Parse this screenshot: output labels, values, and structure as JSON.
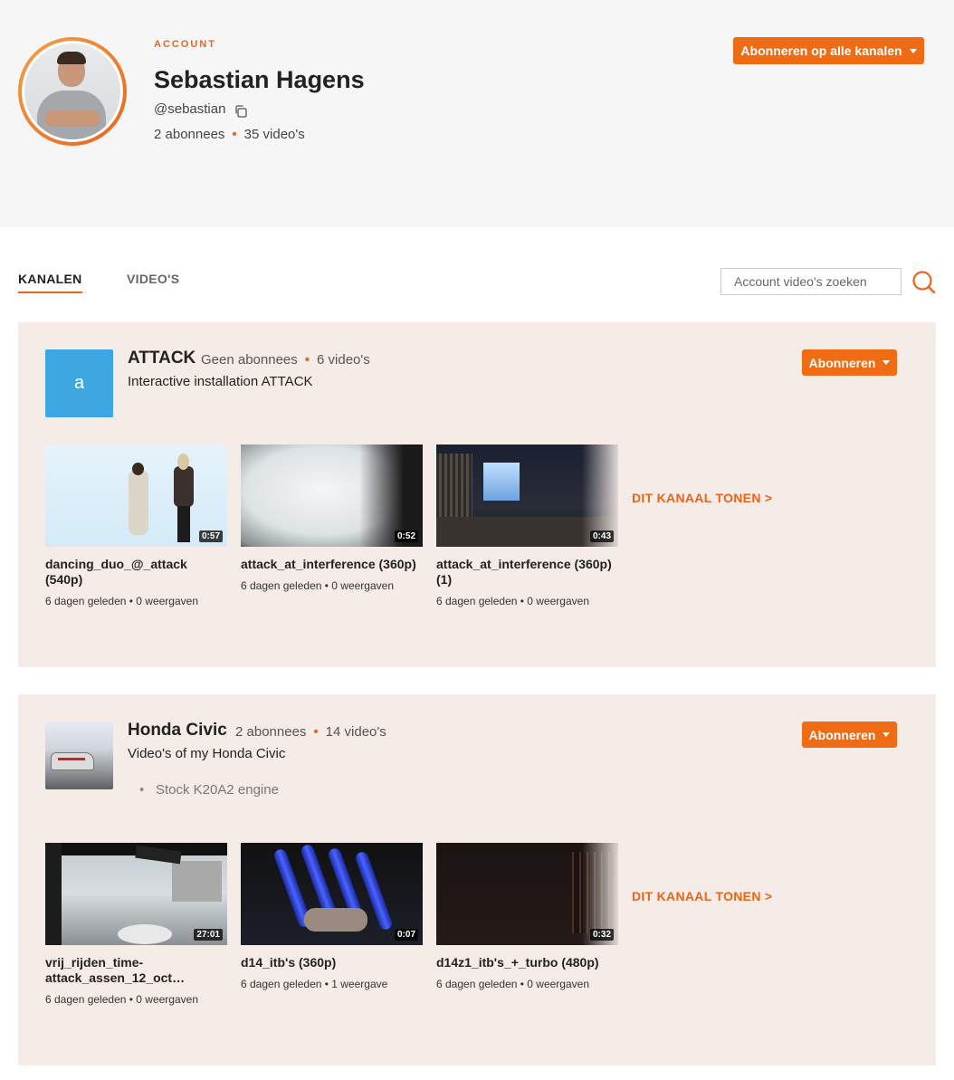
{
  "header": {
    "kicker": "ACCOUNT",
    "name": "Sebastian Hagens",
    "handle": "@sebastian",
    "subscribers": "2 abonnees",
    "videos": "35 video's",
    "subscribe_all_label": "Abonneren op alle kanalen"
  },
  "tabs": [
    {
      "label": "KANALEN",
      "active": true
    },
    {
      "label": "VIDEO'S",
      "active": false
    }
  ],
  "search": {
    "placeholder": "Account video's zoeken"
  },
  "colors": {
    "accent": "#e8651a",
    "button": "#ef6c15",
    "card_bg": "#f5ebe7",
    "header_bg": "#f6f6f7",
    "channel_letter_bg": "#3ea6e0"
  },
  "channels": [
    {
      "thumb_letter": "a",
      "title": "ATTACK",
      "subscribers": "Geen abonnees",
      "videos": "6 video's",
      "description": "Interactive installation ATTACK",
      "subscribe_label": "Abonneren",
      "show_label": "DIT KANAAL TONEN >",
      "video_list": [
        {
          "title": "dancing_duo_@_attack (540p)",
          "duration": "0:57",
          "meta": "6 dagen geleden • 0 weergaven"
        },
        {
          "title": "attack_at_interference (360p)",
          "duration": "0:52",
          "meta": "6 dagen geleden • 0 weergaven"
        },
        {
          "title": "attack_at_interference (360p) (1)",
          "duration": "0:43",
          "meta": "6 dagen geleden • 0 weergaven"
        }
      ]
    },
    {
      "title": "Honda Civic",
      "subscribers": "2 abonnees",
      "videos": "14 video's",
      "description": "Video's of my Honda Civic",
      "bullet": "Stock K20A2 engine",
      "subscribe_label": "Abonneren",
      "show_label": "DIT KANAAL TONEN >",
      "video_list": [
        {
          "title": "vrij_rijden_time-attack_assen_12_oct…",
          "duration": "27:01",
          "meta": "6 dagen geleden • 0 weergaven"
        },
        {
          "title": "d14_itb's (360p)",
          "duration": "0:07",
          "meta": "6 dagen geleden • 1 weergave"
        },
        {
          "title": "d14z1_itb's_+_turbo (480p)",
          "duration": "0:32",
          "meta": "6 dagen geleden • 0 weergaven"
        }
      ]
    }
  ]
}
